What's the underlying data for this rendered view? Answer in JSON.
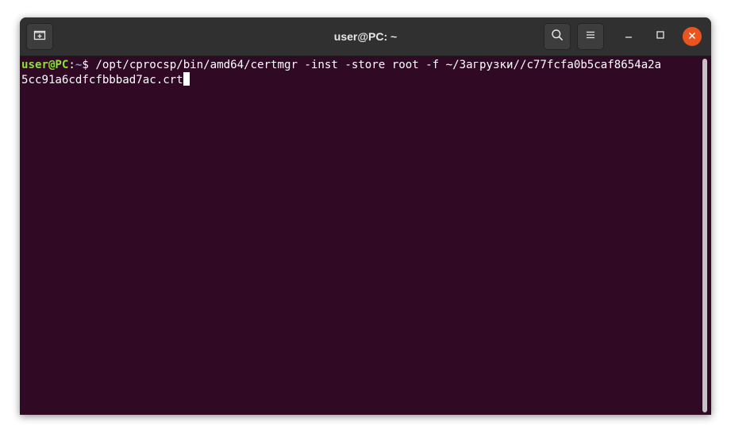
{
  "window": {
    "title": "user@PC: ~"
  },
  "titlebar_icons": {
    "new_tab": "new-tab-icon",
    "search": "search-icon",
    "menu": "hamburger-menu-icon",
    "minimize": "minimize-icon",
    "maximize": "maximize-icon",
    "close": "close-icon"
  },
  "terminal": {
    "prompt_user": "user@PC",
    "prompt_sep": ":",
    "prompt_path": "~",
    "prompt_symbol": "$ ",
    "command_line1": "/opt/cprocsp/bin/amd64/certmgr -inst -store root -f ~/Загрузки//c77fcfa0b5caf8654a2a",
    "command_line2": "5cc91a6cdfcfbbbad7ac.crt"
  },
  "colors": {
    "terminal_bg": "#300a24",
    "titlebar_bg": "#303030",
    "prompt_user": "#8ae234",
    "prompt_path": "#729fcf",
    "close_button": "#e95420"
  }
}
